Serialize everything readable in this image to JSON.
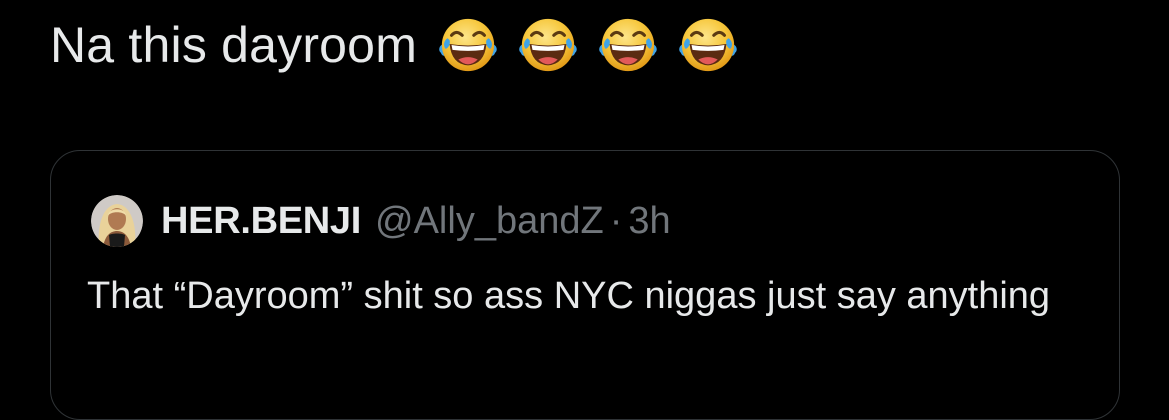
{
  "tweet": {
    "text": "Na this dayroom",
    "emojis": [
      "face-with-tears-of-joy-icon",
      "face-with-tears-of-joy-icon",
      "face-with-tears-of-joy-icon",
      "face-with-tears-of-joy-icon"
    ]
  },
  "quoted_tweet": {
    "display_name": "HER.BENJI",
    "handle": "@Ally_bandZ",
    "separator": "·",
    "time": "3h",
    "text": "That “Dayroom” shit so ass NYC niggas just say anything"
  },
  "colors": {
    "background": "#000000",
    "primary_text": "#e7e9ea",
    "secondary_text": "#71767b",
    "border": "#2f3336",
    "emoji_face": "#f6c63a",
    "emoji_tears": "#3fa3e8"
  }
}
